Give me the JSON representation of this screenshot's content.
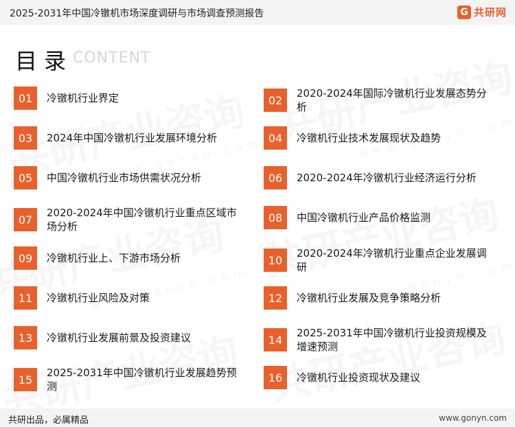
{
  "header": {
    "title": "2025-2031年中国冷镦机市场深度调研与市场调查预测报告",
    "logo_mark": "G",
    "logo_text": "共研网"
  },
  "toc": {
    "heading": "目录",
    "heading_en": "CONTENT",
    "items": [
      {
        "num": "01",
        "text": "冷镦机行业界定"
      },
      {
        "num": "02",
        "text": "2020-2024年国际冷镦机行业发展态势分析"
      },
      {
        "num": "03",
        "text": "2024年中国冷镦机行业发展环境分析"
      },
      {
        "num": "04",
        "text": "冷镦机行业技术发展现状及趋势"
      },
      {
        "num": "05",
        "text": "中国冷镦机行业市场供需状况分析"
      },
      {
        "num": "06",
        "text": "2020-2024年冷镦机行业经济运行分析"
      },
      {
        "num": "07",
        "text": "2020-2024年中国冷镦机行业重点区域市场分析"
      },
      {
        "num": "08",
        "text": "中国冷镦机行业产品价格监测"
      },
      {
        "num": "09",
        "text": "冷镦机行业上、下游市场分析"
      },
      {
        "num": "10",
        "text": "2020-2024年冷镦机行业重点企业发展调研"
      },
      {
        "num": "11",
        "text": "冷镦机行业风险及对策"
      },
      {
        "num": "12",
        "text": "冷镦机行业发展及竞争策略分析"
      },
      {
        "num": "13",
        "text": "冷镦机行业发展前景及投资建议"
      },
      {
        "num": "14",
        "text": "2025-2031年中国冷镦机行业投资规模及增速预测"
      },
      {
        "num": "15",
        "text": "2025-2031年中国冷镦机行业发展趋势预测"
      },
      {
        "num": "16",
        "text": "冷镦机行业投资现状及建议"
      }
    ]
  },
  "watermark": {
    "text": "共研产业咨询",
    "sub": "www.gonyn.com"
  },
  "footer": {
    "slogan": "共研出品，必属精品",
    "site": "www.gonyn.com"
  },
  "colors": {
    "accent": "#e8612c",
    "bar_bg": "#f4f4f4"
  }
}
